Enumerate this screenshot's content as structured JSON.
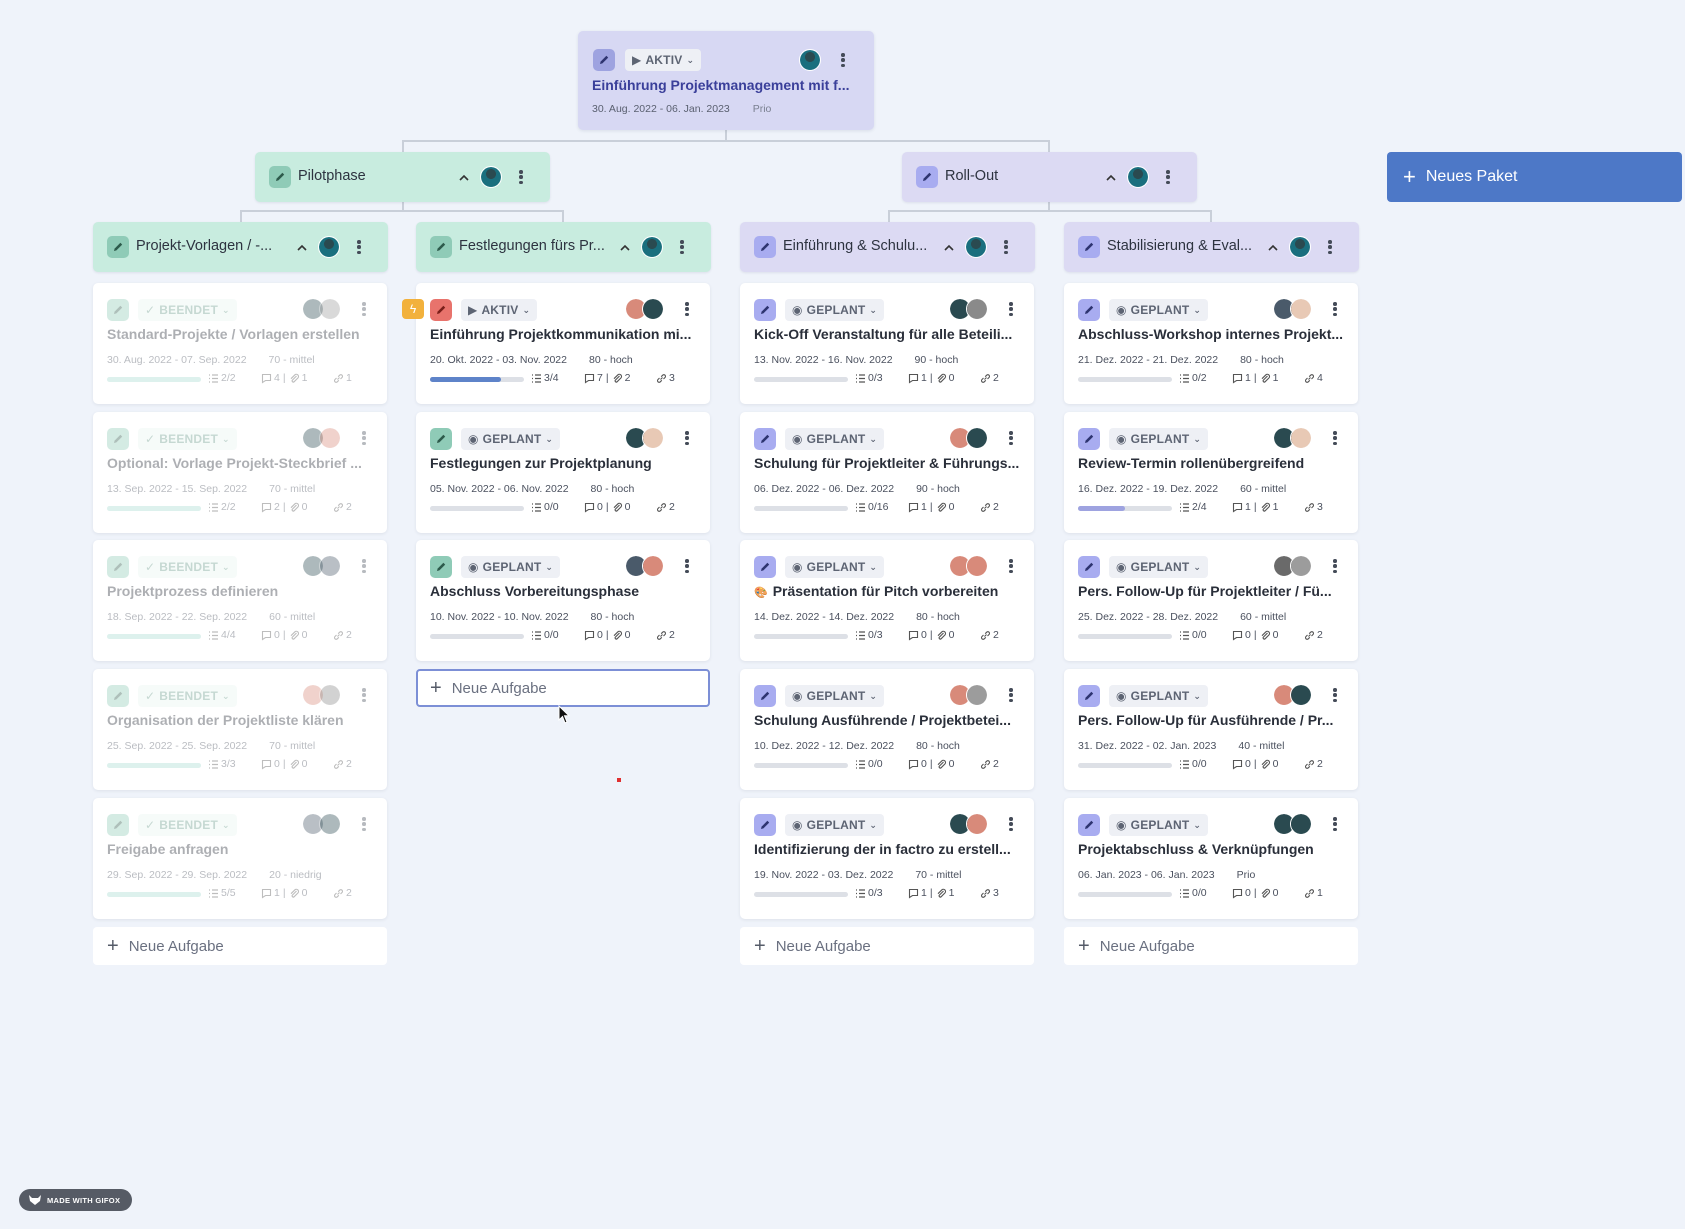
{
  "colors": {
    "green_phase": "#c8ecdf",
    "purple_phase": "#dcdaf3",
    "project_bg": "#d7d8f3",
    "accent_blue": "#4d78c7",
    "progress_blue": "#5e83c9",
    "progress_teal": "#a8dcd0",
    "progress_lilac": "#9ea3e0"
  },
  "project": {
    "status": "AKTIV",
    "title": "Einführung Projektmanagement mit f...",
    "dates": "30. Aug. 2022 - 06. Jan. 2023",
    "prio": "Prio"
  },
  "phases": [
    {
      "title": "Pilotphase"
    },
    {
      "title": "Roll-Out"
    }
  ],
  "new_package": {
    "label": "Neues Paket"
  },
  "packages": [
    {
      "title": "Projekt-Vorlagen / -..."
    },
    {
      "title": "Festlegungen fürs Pr..."
    },
    {
      "title": "Einführung & Schulu..."
    },
    {
      "title": "Stabilisierung & Eval..."
    }
  ],
  "columns": [
    {
      "tasks": [
        {
          "status": "BEENDET",
          "title": "Standard-Projekte / Vorlagen erstellen",
          "dates": "30. Aug. 2022 - 07. Sep. 2022",
          "prio": "70 - mittel",
          "checklist": "2/2",
          "comments": "4",
          "attachments": "1",
          "links": "1",
          "progress": 1.0
        },
        {
          "status": "BEENDET",
          "title": "Optional: Vorlage Projekt-Steckbrief ...",
          "dates": "13. Sep. 2022 - 15. Sep. 2022",
          "prio": "70 - mittel",
          "checklist": "2/2",
          "comments": "2",
          "attachments": "0",
          "links": "2",
          "progress": 1.0
        },
        {
          "status": "BEENDET",
          "title": "Projektprozess definieren",
          "dates": "18. Sep. 2022 - 22. Sep. 2022",
          "prio": "60 - mittel",
          "checklist": "4/4",
          "comments": "0",
          "attachments": "0",
          "links": "2",
          "progress": 1.0
        },
        {
          "status": "BEENDET",
          "title": "Organisation der Projektliste klären",
          "dates": "25. Sep. 2022 - 25. Sep. 2022",
          "prio": "70 - mittel",
          "checklist": "3/3",
          "comments": "0",
          "attachments": "0",
          "links": "2",
          "progress": 1.0
        },
        {
          "status": "BEENDET",
          "title": "Freigabe anfragen",
          "dates": "29. Sep. 2022 - 29. Sep. 2022",
          "prio": "20 - niedrig",
          "checklist": "5/5",
          "comments": "1",
          "attachments": "0",
          "links": "2",
          "progress": 1.0
        }
      ],
      "new_task": "Neue Aufgabe"
    },
    {
      "tasks": [
        {
          "status": "AKTIV",
          "title": "Einführung Projektkommunikation mi...",
          "dates": "20. Okt. 2022 - 03. Nov. 2022",
          "prio": "80 - hoch",
          "checklist": "3/4",
          "comments": "7",
          "attachments": "2",
          "links": "3",
          "progress": 0.75
        },
        {
          "status": "GEPLANT",
          "title": "Festlegungen zur Projektplanung",
          "dates": "05. Nov. 2022 - 06. Nov. 2022",
          "prio": "80 - hoch",
          "checklist": "0/0",
          "comments": "0",
          "attachments": "0",
          "links": "2",
          "progress": 0
        },
        {
          "status": "GEPLANT",
          "title": "Abschluss Vorbereitungsphase",
          "dates": "10. Nov. 2022 - 10. Nov. 2022",
          "prio": "80 - hoch",
          "checklist": "0/0",
          "comments": "0",
          "attachments": "0",
          "links": "2",
          "progress": 0
        }
      ],
      "new_task": "Neue Aufgabe"
    },
    {
      "tasks": [
        {
          "status": "GEPLANT",
          "title": "Kick-Off Veranstaltung für alle Beteili...",
          "dates": "13. Nov. 2022 - 16. Nov. 2022",
          "prio": "90 - hoch",
          "checklist": "0/3",
          "comments": "1",
          "attachments": "0",
          "links": "2",
          "progress": 0
        },
        {
          "status": "GEPLANT",
          "title": "Schulung für Projektleiter & Führungs...",
          "dates": "06. Dez. 2022 - 06. Dez. 2022",
          "prio": "90 - hoch",
          "checklist": "0/16",
          "comments": "1",
          "attachments": "0",
          "links": "2",
          "progress": 0
        },
        {
          "status": "GEPLANT",
          "title": "Präsentation für Pitch vorbereiten",
          "dates": "14. Dez. 2022 - 14. Dez. 2022",
          "prio": "80 - hoch",
          "checklist": "0/3",
          "comments": "0",
          "attachments": "0",
          "links": "2",
          "progress": 0
        },
        {
          "status": "GEPLANT",
          "title": "Schulung Ausführende / Projektbetei...",
          "dates": "10. Dez. 2022 - 12. Dez. 2022",
          "prio": "80 - hoch",
          "checklist": "0/0",
          "comments": "0",
          "attachments": "0",
          "links": "2",
          "progress": 0
        },
        {
          "status": "GEPLANT",
          "title": "Identifizierung der in factro zu erstell...",
          "dates": "19. Nov. 2022 - 03. Dez. 2022",
          "prio": "70 - mittel",
          "checklist": "0/3",
          "comments": "1",
          "attachments": "1",
          "links": "3",
          "progress": 0
        }
      ],
      "new_task": "Neue Aufgabe"
    },
    {
      "tasks": [
        {
          "status": "GEPLANT",
          "title": "Abschluss-Workshop internes Projekt...",
          "dates": "21. Dez. 2022 - 21. Dez. 2022",
          "prio": "80 - hoch",
          "checklist": "0/2",
          "comments": "1",
          "attachments": "1",
          "links": "4",
          "progress": 0
        },
        {
          "status": "GEPLANT",
          "title": "Review-Termin rollenübergreifend",
          "dates": "16. Dez. 2022 - 19. Dez. 2022",
          "prio": "60 - mittel",
          "checklist": "2/4",
          "comments": "1",
          "attachments": "1",
          "links": "3",
          "progress": 0.5
        },
        {
          "status": "GEPLANT",
          "title": "Pers. Follow-Up für Projektleiter / Fü...",
          "dates": "25. Dez. 2022 - 28. Dez. 2022",
          "prio": "60 - mittel",
          "checklist": "0/0",
          "comments": "0",
          "attachments": "0",
          "links": "2",
          "progress": 0
        },
        {
          "status": "GEPLANT",
          "title": "Pers. Follow-Up für Ausführende / Pr...",
          "dates": "31. Dez. 2022 - 02. Jan. 2023",
          "prio": "40 - mittel",
          "checklist": "0/0",
          "comments": "0",
          "attachments": "0",
          "links": "2",
          "progress": 0
        },
        {
          "status": "GEPLANT",
          "title": "Projektabschluss & Verknüpfungen",
          "dates": "06. Jan. 2023 - 06. Jan. 2023",
          "prio": "Prio",
          "checklist": "0/0",
          "comments": "0",
          "attachments": "0",
          "links": "1",
          "progress": 0
        }
      ],
      "new_task": "Neue Aufgabe"
    }
  ],
  "watermark": {
    "label": "MADE WITH GIFOX"
  }
}
